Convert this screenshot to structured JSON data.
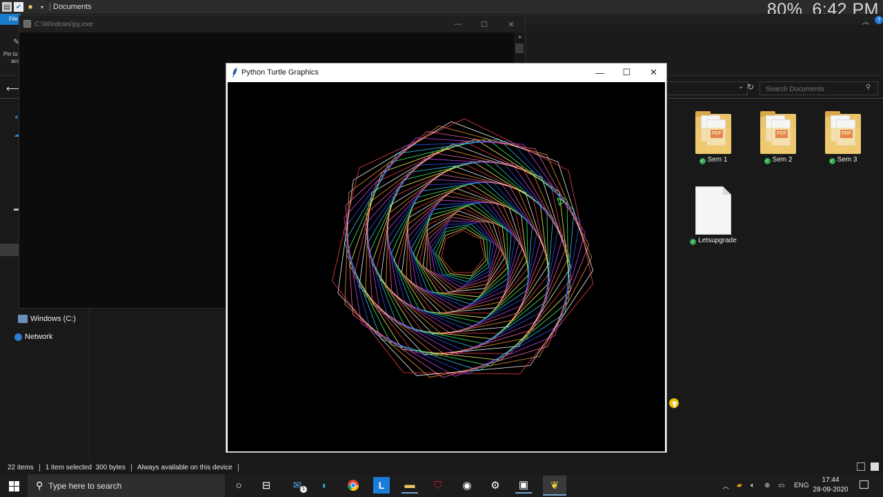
{
  "explorer": {
    "title": "Documents",
    "file_tab": "File",
    "pin_label_line1": "Pin to",
    "pin_label_line2": "acc",
    "search_placeholder": "Search Documents",
    "nav": {
      "drive": "Windows (C:)",
      "network": "Network"
    },
    "files": [
      {
        "name": "Sem 1",
        "type": "pdf-folder"
      },
      {
        "name": "Sem 2",
        "type": "pdf-folder"
      },
      {
        "name": "Sem 3",
        "type": "pdf-folder"
      },
      {
        "name": "Letsupgrade",
        "type": "text-file"
      }
    ],
    "status": {
      "items": "22 items",
      "selected": "1 item selected  300 bytes",
      "availability": "Always available on this device"
    }
  },
  "overlay": {
    "zoom": "80%",
    "time": "6:42 PM"
  },
  "console_window": {
    "title": "C:\\Windows\\py.exe"
  },
  "turtle_window": {
    "title": "Python Turtle Graphics",
    "drawing": {
      "background": "#000000",
      "shape": "heptagon-spiral",
      "sides": 7,
      "palette": [
        "#ff4444",
        "#ffff66",
        "#44ff66",
        "#33ccff",
        "#3355ff",
        "#cc44ff",
        "#ff66aa",
        "#ff9933",
        "#ffffff"
      ]
    }
  },
  "taskbar": {
    "search_placeholder": "Type here to search",
    "mail_badge": "1",
    "lang": "ENG",
    "clock_time": "17:44",
    "clock_date": "28-09-2020"
  },
  "colors": {
    "accent": "#1979ca",
    "sync_ok": "#32a852",
    "folder": "#e9c46a",
    "pdf_red": "#d52b1e",
    "cursor_highlight": "#e8c20a"
  }
}
